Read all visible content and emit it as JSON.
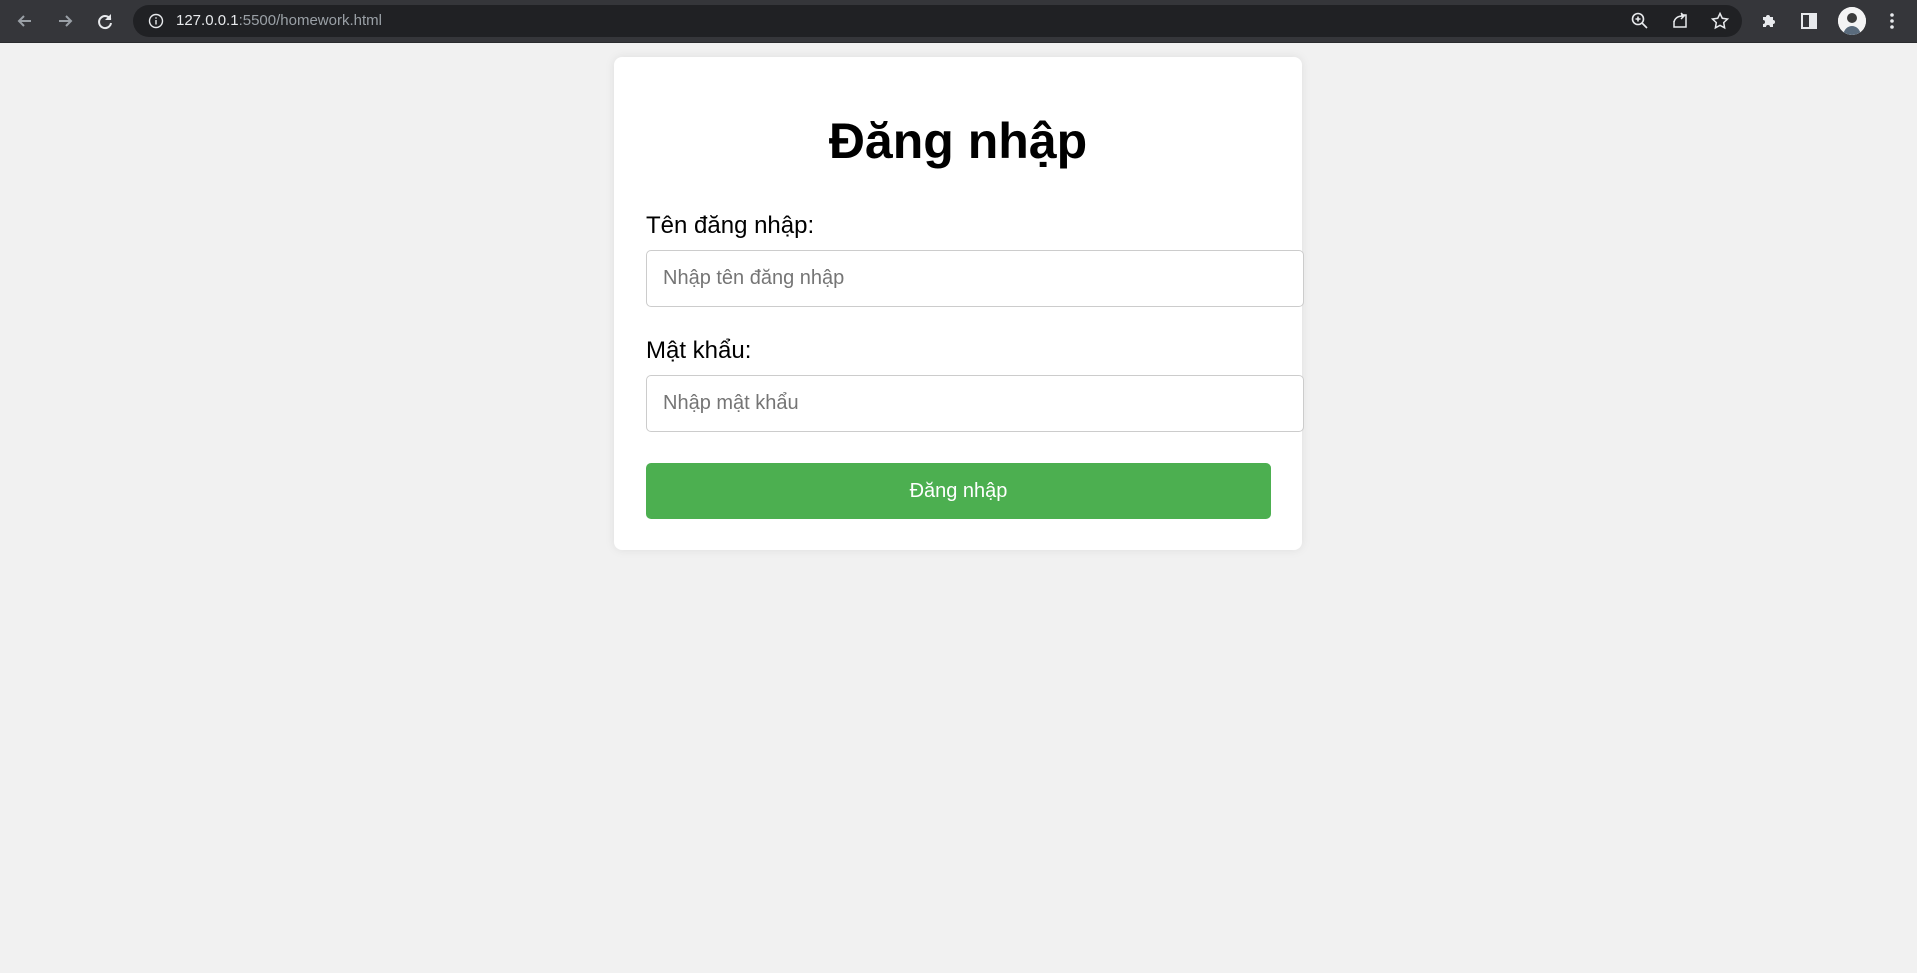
{
  "browser": {
    "url_host": "127.0.0.1",
    "url_rest": ":5500/homework.html",
    "icons": {
      "back": "arrow-left-icon",
      "forward": "arrow-right-icon",
      "reload": "reload-icon",
      "info": "info-icon",
      "zoom": "zoom-icon",
      "share": "share-icon",
      "bookmark": "star-icon",
      "extensions": "puzzle-icon",
      "side_panel": "side-panel-icon",
      "menu": "kebab-menu-icon"
    }
  },
  "login": {
    "title": "Đăng nhập",
    "username_label": "Tên đăng nhập:",
    "username_placeholder": "Nhập tên đăng nhập",
    "password_label": "Mật khẩu:",
    "password_placeholder": "Nhập mật khẩu",
    "submit_label": "Đăng nhập"
  },
  "colors": {
    "page_background": "#f1f1f1",
    "card_background": "#ffffff",
    "button_background": "#4caf50",
    "toolbar_background": "#35363a"
  }
}
